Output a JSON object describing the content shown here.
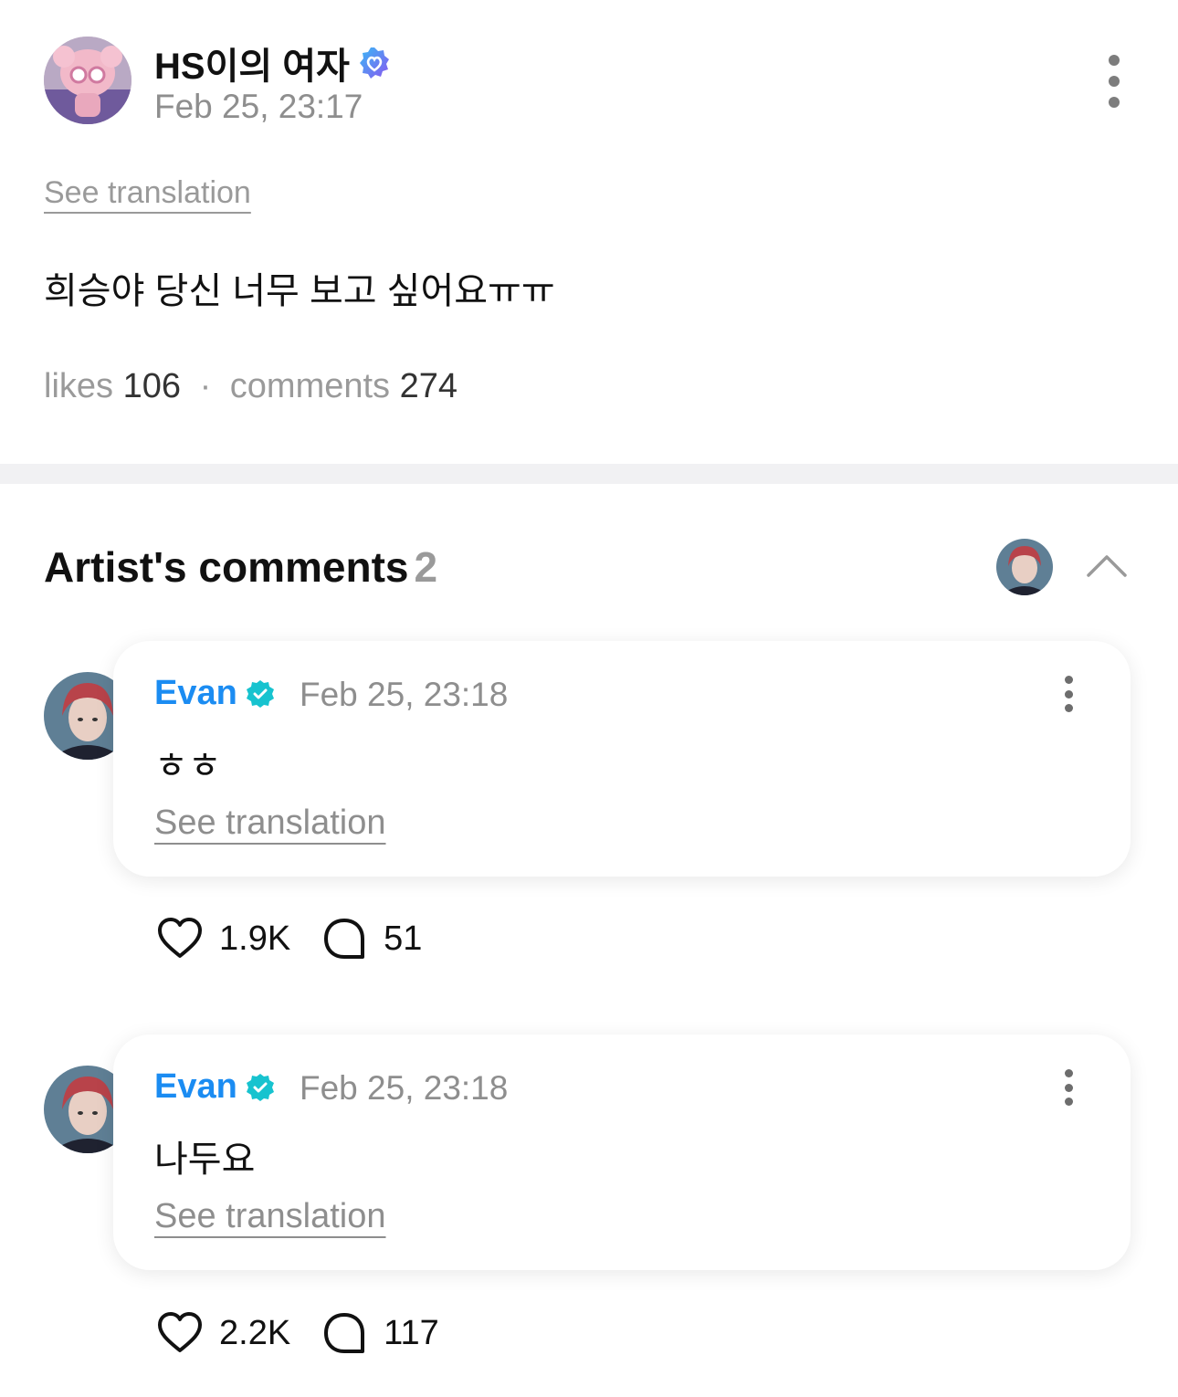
{
  "post": {
    "author_name": "HS이의 여자",
    "timestamp": "Feb 25, 23:17",
    "see_translation": "See translation",
    "body": "희승야 당신 너무 보고 싶어요ㅠㅠ",
    "likes_label": "likes",
    "likes_count": "106",
    "separator": "·",
    "comments_label": "comments",
    "comments_count": "274"
  },
  "artist_comments": {
    "title": "Artist's comments",
    "count": "2",
    "items": [
      {
        "author": "Evan",
        "timestamp": "Feb 25, 23:18",
        "text": "ㅎㅎ",
        "see_translation": "See translation",
        "likes": "1.9K",
        "replies": "51"
      },
      {
        "author": "Evan",
        "timestamp": "Feb 25, 23:18",
        "text": "나두요",
        "see_translation": "See translation",
        "likes": "2.2K",
        "replies": "117"
      }
    ]
  },
  "colors": {
    "artist_name": "#1b8cf2",
    "verified_badge_artist": "#17c3cf",
    "muted_text": "#8e8e8e",
    "divider": "#f1f1f3"
  },
  "icons": {
    "user_verified": "verified-heart-badge-icon",
    "artist_verified": "verified-check-badge-icon",
    "more": "more-vertical-icon",
    "collapse": "chevron-up-icon",
    "like": "heart-outline-icon",
    "reply": "speech-bubble-icon"
  }
}
